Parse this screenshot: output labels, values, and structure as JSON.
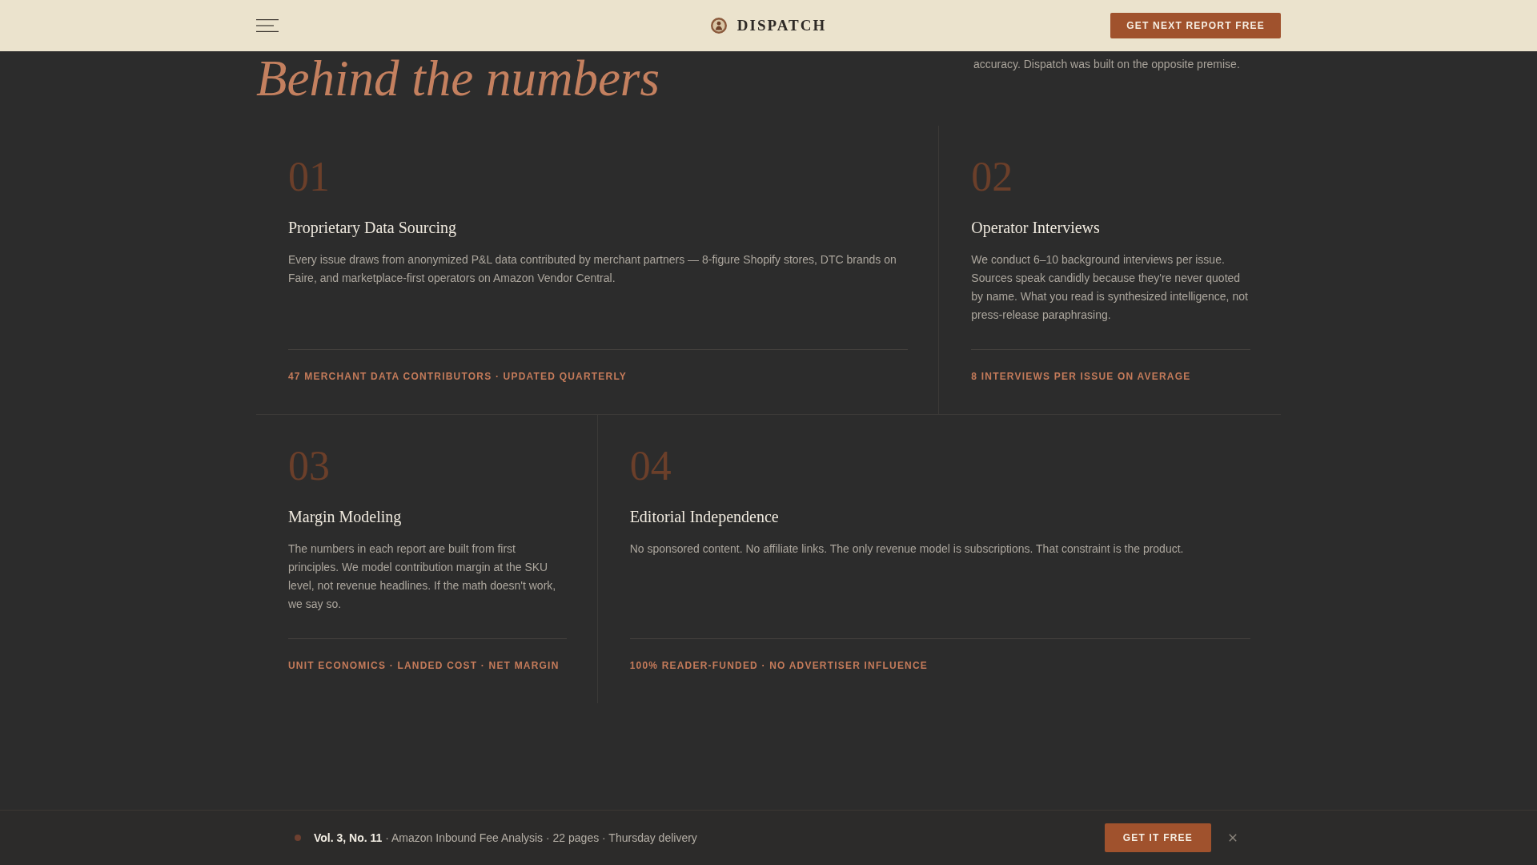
{
  "header": {
    "brand": "DISPATCH",
    "cta": "GET NEXT REPORT FREE"
  },
  "intro": {
    "heading": "Behind the numbers",
    "text": "accuracy. Dispatch was built on the opposite premise."
  },
  "pillars": [
    {
      "number": "01",
      "title": "Proprietary Data Sourcing",
      "text": "Every issue draws from anonymized P&L data contributed by merchant partners — 8-figure Shopify stores, DTC brands on Faire, and marketplace-first operators on Amazon Vendor Central.",
      "tag": "47 MERCHANT DATA CONTRIBUTORS · UPDATED QUARTERLY"
    },
    {
      "number": "02",
      "title": "Operator Interviews",
      "text": "We conduct 6–10 background interviews per issue. Sources speak candidly because they're never quoted by name. What you read is synthesized intelligence, not press-release paraphrasing.",
      "tag": "8 INTERVIEWS PER ISSUE ON AVERAGE"
    },
    {
      "number": "03",
      "title": "Margin Modeling",
      "text": "The numbers in each report are built from first principles. We model contribution margin at the SKU level, not revenue headlines. If the math doesn't work, we say so.",
      "tag": "UNIT ECONOMICS · LANDED COST · NET MARGIN"
    },
    {
      "number": "04",
      "title": "Editorial Independence",
      "text": "No sponsored content. No affiliate links. The only revenue model is subscriptions. That constraint is the product.",
      "tag": "100% READER-FUNDED · NO ADVERTISER INFLUENCE"
    }
  ],
  "promo_bar": {
    "text": "**Vol. 3, No. 11** · Amazon Inbound Fee Analysis · 22 pages · Thursday delivery",
    "button": "GET IT FREE"
  }
}
